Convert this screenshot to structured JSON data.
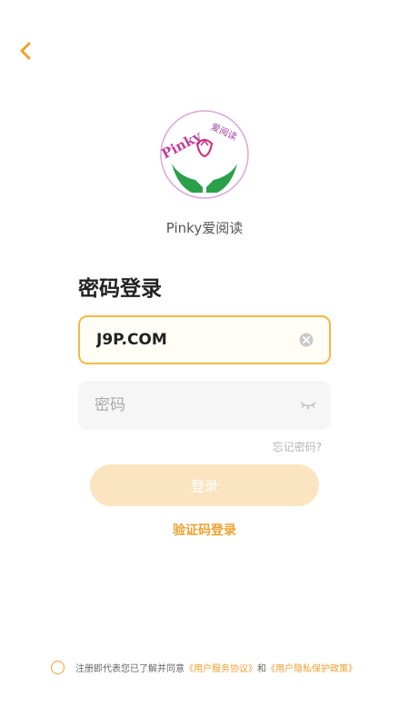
{
  "app": {
    "name": "Pinky爱阅读"
  },
  "logo": {
    "text": "Pinky",
    "glyphs": "爱阅读"
  },
  "page": {
    "title": "密码登录"
  },
  "form": {
    "username_value": "J9P.COM",
    "password_placeholder": "密码",
    "forgot_label": "忘记密码?",
    "login_label": "登录",
    "code_login_label": "验证码登录"
  },
  "agreement": {
    "prefix": "注册即代表您已了解并同意",
    "service_link": "《用户服务协议》",
    "and": "和",
    "privacy_link": "《用户隐私保护政策》"
  },
  "icons": {
    "back": "chevron-left-icon",
    "clear": "clear-icon",
    "visibility": "eye-closed-icon"
  },
  "colors": {
    "accent": "#f0a030",
    "input_border": "#f5b942",
    "button_disabled": "#fae5c0"
  }
}
